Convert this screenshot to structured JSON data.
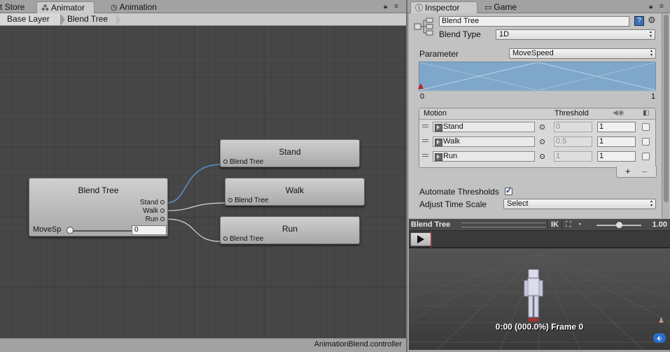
{
  "left_tabs": [
    {
      "label": "t Store",
      "icon": ""
    },
    {
      "label": "Animator",
      "icon": "animator-icon"
    },
    {
      "label": "Animation",
      "icon": "clock-icon"
    }
  ],
  "breadcrumb": [
    "Base Layer",
    "Blend Tree"
  ],
  "graph": {
    "blend_node": {
      "title": "Blend Tree",
      "outputs": [
        "Stand",
        "Walk",
        "Run"
      ],
      "param_label": "MoveSp",
      "param_value": "0"
    },
    "motion_nodes": [
      {
        "title": "Stand",
        "input": "Blend Tree"
      },
      {
        "title": "Walk",
        "input": "Blend Tree"
      },
      {
        "title": "Run",
        "input": "Blend Tree"
      }
    ],
    "wire_colors": {
      "active": "#5a8fd0",
      "inactive": "#d8d8d8"
    }
  },
  "status": {
    "controller": "AnimationBlend.controller"
  },
  "right_tabs": [
    {
      "label": "Inspector",
      "icon": "info-icon"
    },
    {
      "label": "Game",
      "icon": ""
    }
  ],
  "inspector": {
    "name": "Blend Tree",
    "blend_type_label": "Blend Type",
    "blend_type": "1D",
    "parameter_label": "Parameter",
    "parameter": "MoveSpeed",
    "range_min": "0",
    "range_max": "1",
    "table": {
      "col_motion": "Motion",
      "col_threshold": "Threshold",
      "rows": [
        {
          "motion": "Stand",
          "threshold": "0",
          "speed": "1"
        },
        {
          "motion": "Walk",
          "threshold": "0.5",
          "speed": "1"
        },
        {
          "motion": "Run",
          "threshold": "1",
          "speed": "1"
        }
      ]
    },
    "automate_thresholds_label": "Automate Thresholds",
    "automate_thresholds": true,
    "adjust_time_scale_label": "Adjust Time Scale",
    "adjust_time_scale": "Select",
    "plus": "+",
    "minus": "–"
  },
  "preview": {
    "title": "Blend Tree",
    "ik": "IK",
    "speed": "1.00",
    "time": "0:00 (000.0%) Frame 0"
  }
}
